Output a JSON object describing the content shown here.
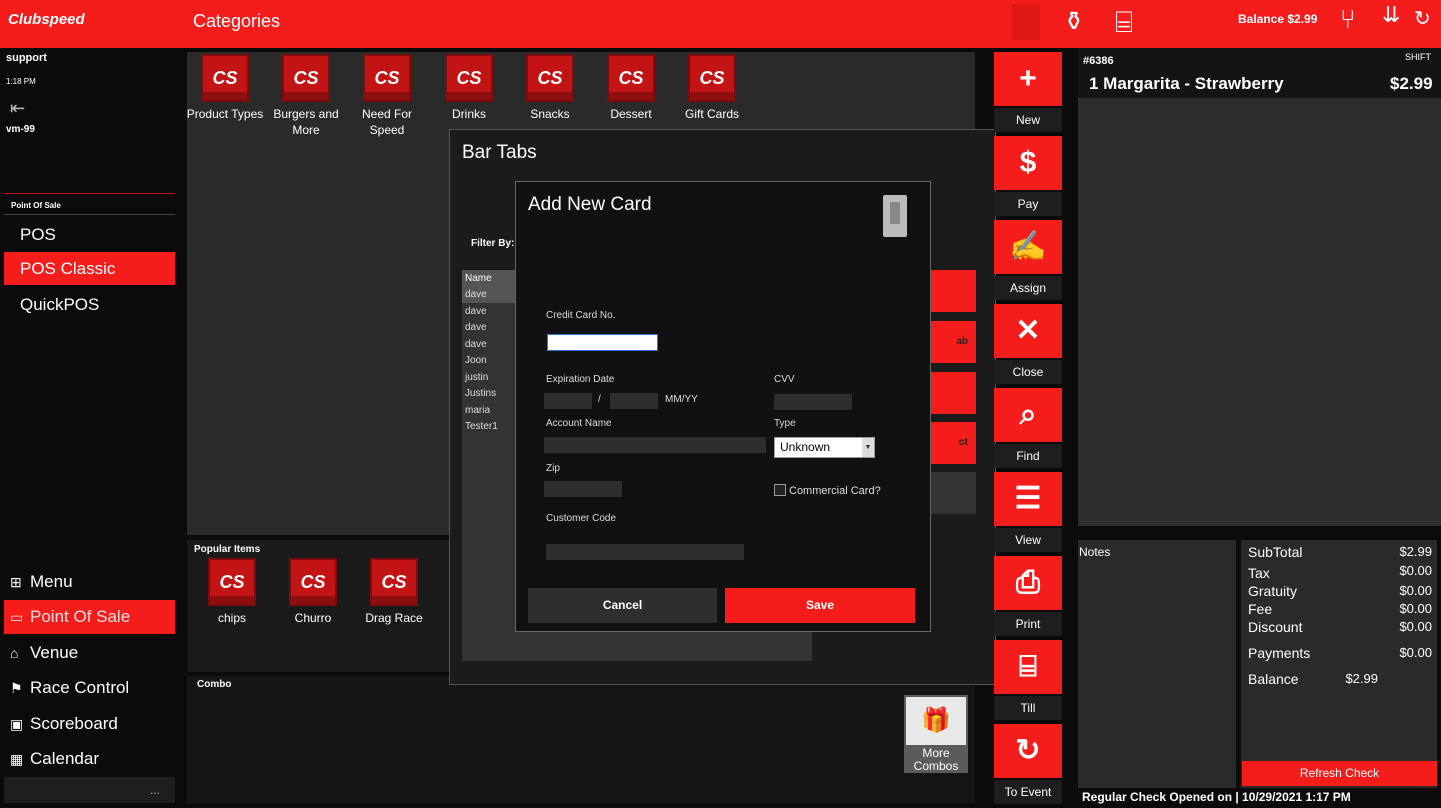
{
  "header": {
    "logo": "Clubspeed",
    "title": "Categories",
    "balance": "Balance $2.99"
  },
  "session": {
    "user": "support",
    "time": "1:18 PM",
    "terminal": "vm-99"
  },
  "sidebar": {
    "section": "Point Of Sale",
    "items": [
      {
        "label": "POS"
      },
      {
        "label": "POS Classic"
      },
      {
        "label": "QuickPOS"
      }
    ],
    "bottom": [
      {
        "label": "Menu"
      },
      {
        "label": "Point Of Sale"
      },
      {
        "label": "Venue"
      },
      {
        "label": "Race Control"
      },
      {
        "label": "Scoreboard"
      },
      {
        "label": "Calendar"
      }
    ],
    "more": "..."
  },
  "categories": [
    {
      "icon": "CS",
      "label": "Product Types"
    },
    {
      "icon": "CS",
      "label": "Burgers and More"
    },
    {
      "icon": "CS",
      "label": "Need For Speed"
    },
    {
      "icon": "CS",
      "label": "Drinks"
    },
    {
      "icon": "CS",
      "label": "Snacks"
    },
    {
      "icon": "CS",
      "label": "Dessert"
    },
    {
      "icon": "CS",
      "label": "Gift Cards"
    }
  ],
  "popular": {
    "title": "Popular Items",
    "items": [
      {
        "icon": "CS",
        "label": "chips"
      },
      {
        "icon": "CS",
        "label": "Churro"
      },
      {
        "icon": "CS",
        "label": "Drag Race"
      }
    ]
  },
  "combo": {
    "title": "Combo",
    "more": "More Combos"
  },
  "bartabs": {
    "title": "Bar Tabs",
    "filter": "Filter By:",
    "col": "Name",
    "names": [
      "dave",
      "dave",
      "dave",
      "dave",
      "Joon",
      "justin",
      "Justins",
      "maria",
      "Tester1"
    ],
    "btn2": "ab",
    "btn4": "ot"
  },
  "addcard": {
    "title": "Add New Card",
    "cc_label": "Credit Card No.",
    "cc_value": "",
    "exp_label": "Expiration Date",
    "slash": "/",
    "mmyy": "MM/YY",
    "cvv_label": "CVV",
    "acct_label": "Account Name",
    "type_label": "Type",
    "type_value": "Unknown",
    "zip_label": "Zip",
    "commercial": "Commercial Card?",
    "cust_label": "Customer Code",
    "cancel": "Cancel",
    "save": "Save"
  },
  "actions": [
    {
      "icon": "+",
      "label": "New"
    },
    {
      "icon": "$",
      "label": "Pay"
    },
    {
      "icon": "✍",
      "label": "Assign"
    },
    {
      "icon": "✕",
      "label": "Close"
    },
    {
      "icon": "⌕",
      "label": "Find"
    },
    {
      "icon": "☰",
      "label": "View"
    },
    {
      "icon": "⎙",
      "label": "Print"
    },
    {
      "icon": "⌸",
      "label": "Till"
    },
    {
      "icon": "↻",
      "label": "To Event"
    }
  ],
  "check": {
    "number": "#6386",
    "shift": "SHIFT",
    "item": "1  Margarita - Strawberry",
    "price": "$2.99"
  },
  "notes": {
    "label": "Notes"
  },
  "totals": {
    "subtotal_l": "SubTotal",
    "subtotal": "$2.99",
    "tax_l": "Tax",
    "tax": "$0.00",
    "gratuity_l": "Gratuity",
    "gratuity": "$0.00",
    "fee_l": "Fee",
    "fee": "$0.00",
    "discount_l": "Discount",
    "discount": "$0.00",
    "payments_l": "Payments",
    "payments": "$0.00",
    "balance_l": "Balance",
    "balance": "$2.99",
    "refresh": "Refresh Check"
  },
  "footer": "Regular Check Opened on  |  10/29/2021 1:17 PM",
  "colors": {
    "accent": "#f51c1c"
  },
  "icons": {
    "top": [
      "bottles-icon",
      "register-icon",
      "utensils-icon",
      "chevrons-down-icon",
      "refresh-icon"
    ],
    "card": "card-reader-icon"
  }
}
